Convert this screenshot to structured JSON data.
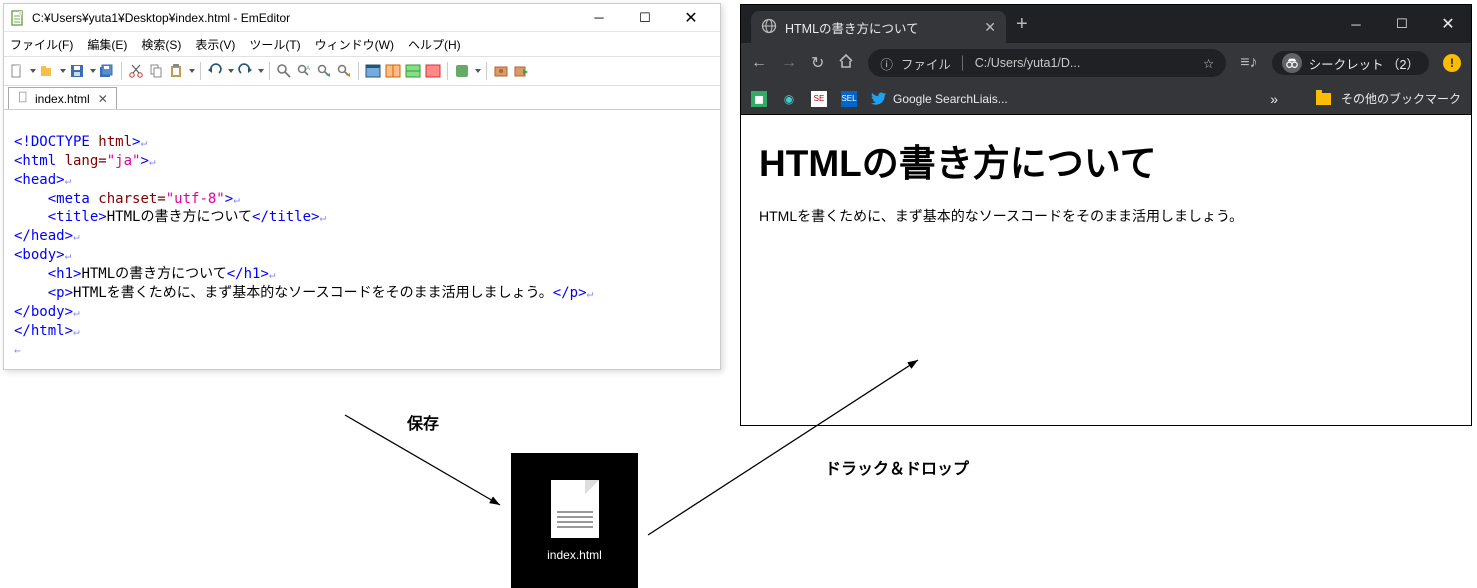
{
  "editor": {
    "title": "C:¥Users¥yuta1¥Desktop¥index.html - EmEditor",
    "menu": [
      "ファイル(F)",
      "編集(E)",
      "検索(S)",
      "表示(V)",
      "ツール(T)",
      "ウィンドウ(W)",
      "ヘルプ(H)"
    ],
    "tab": {
      "name": "index.html"
    },
    "code": {
      "doctype_open": "<!DOCTYPE ",
      "doctype_name": "html",
      "doctype_close": ">",
      "html_tag": "<html ",
      "lang_attr": "lang=",
      "lang_val": "\"ja\"",
      "gt": ">",
      "head_open": "<head>",
      "head_close": "</head>",
      "meta_open": "<meta ",
      "charset_attr": "charset=",
      "charset_val": "\"utf-8\"",
      "title_open": "<title>",
      "title_text": "HTMLの書き方について",
      "title_close": "</title>",
      "body_open": "<body>",
      "body_close": "</body>",
      "h1_open": "<h1>",
      "h1_text": "HTMLの書き方について",
      "h1_close": "</h1>",
      "p_open": "<p>",
      "p_text": "HTMLを書くために、まず基本的なソースコードをそのまま活用しましょう。",
      "p_close": "</p>",
      "html_close": "</html>"
    }
  },
  "browser": {
    "tab_title": "HTMLの書き方について",
    "address_label": "ファイル",
    "address_path": "C:/Users/yuta1/D...",
    "incognito": "シークレット （2）",
    "bookmarks": {
      "search_liaison": "Google SearchLiais...",
      "other": "その他のブックマーク"
    },
    "page_h1": "HTMLの書き方について",
    "page_p": "HTMLを書くために、まず基本的なソースコードをそのまま活用しましょう。"
  },
  "file_icon_label": "index.html",
  "labels": {
    "save": "保存",
    "dragdrop": "ドラック＆ドロップ"
  },
  "bm_badges": {
    "se1": "SE",
    "se2": "SEL"
  }
}
